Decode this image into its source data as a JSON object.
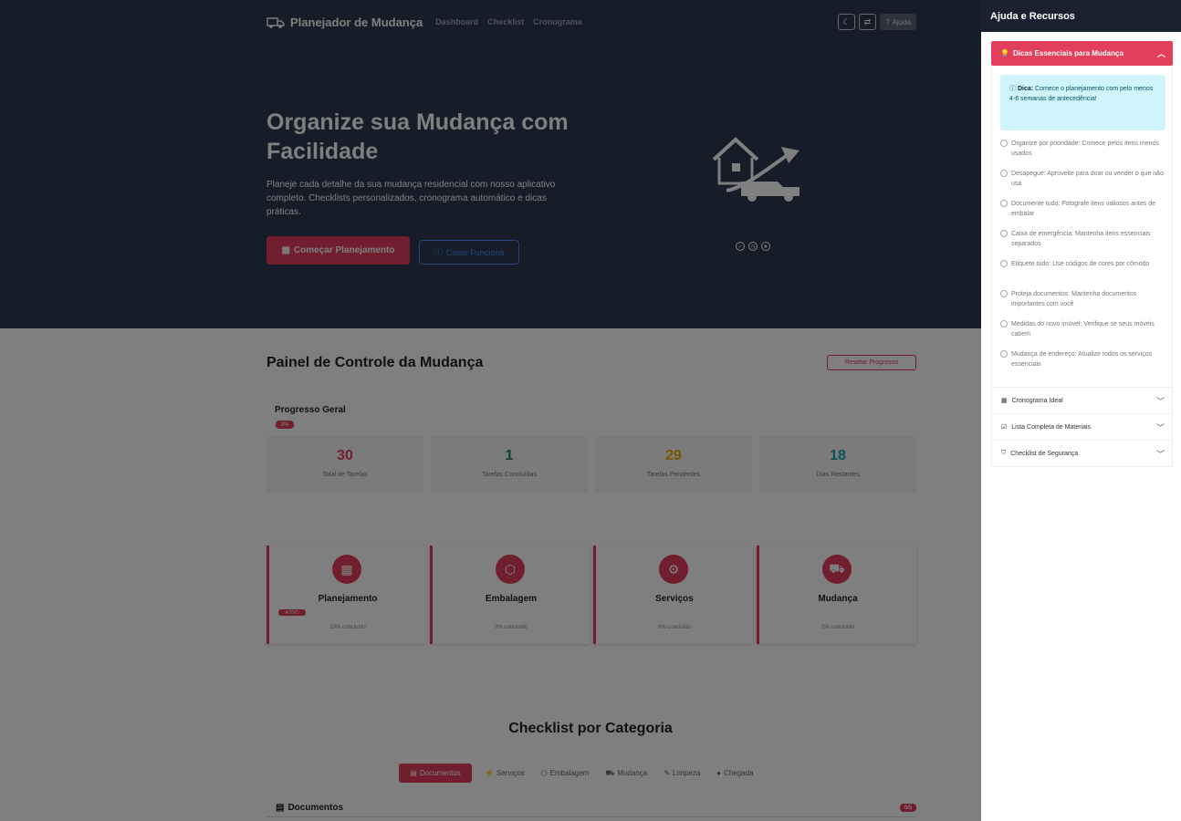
{
  "nav": {
    "brand": "Planejador de Mudança",
    "links": [
      "Dashboard",
      "Checklist",
      "Cronograma"
    ],
    "help_label": "Ajuda"
  },
  "hero": {
    "title": "Organize sua Mudança com Facilidade",
    "text": "Planeje cada detalhe da sua mudança residencial com nosso aplicativo completo. Checklists personalizados, cronograma automático e dicas práticas.",
    "primary_btn": "Começar Planejamento",
    "secondary_btn": "Como Funciona"
  },
  "dashboard": {
    "title": "Painel de Controle da Mudança",
    "reset_btn": "Resetar Progresso",
    "progress_label": "Progresso Geral",
    "progress_badge": "3%",
    "stats": [
      {
        "value": "30",
        "label": "Total de Tarefas",
        "color": "#e33e5c"
      },
      {
        "value": "1",
        "label": "Tarefas Concluídas",
        "color": "#198754"
      },
      {
        "value": "29",
        "label": "Tarefas Pendentes",
        "color": "#f0ad00"
      },
      {
        "value": "18",
        "label": "Dias Restantes",
        "color": "#17a2b8"
      }
    ]
  },
  "categories": [
    {
      "name": "Planejamento",
      "pct": "10% concluído",
      "badge": "ATIVO",
      "icon": "calendar-icon"
    },
    {
      "name": "Embalagem",
      "pct": "0% concluído",
      "icon": "box-icon"
    },
    {
      "name": "Serviços",
      "pct": "0% concluído",
      "icon": "gear-icon"
    },
    {
      "name": "Mudança",
      "pct": "0% concluído",
      "icon": "truck-icon"
    }
  ],
  "checklist": {
    "title": "Checklist por Categoria",
    "tabs": [
      "Documentos",
      "Serviços",
      "Embalagem",
      "Mudança",
      "Limpeza",
      "Chegada"
    ],
    "section_label": "Documentos",
    "section_badge": "0/5"
  },
  "panel": {
    "title": "Ajuda e Recursos",
    "open_section": "Dicas Essenciais para Mudança",
    "tip_bold": "Dica:",
    "tip_text": "Comece o planejamento com pelo menos 4-6 semanas de antecedência!",
    "tips": [
      "Organize por prioridade: Comece pelos itens menos usados",
      "Desapegue: Aproveite para doar ou vender o que não usa",
      "Documente tudo: Fotografe itens valiosos antes de embalar",
      "Caixa de emergência: Mantenha itens essenciais separados",
      "Etiquete tudo: Use códigos de cores por cômodo",
      "Proteja documentos: Mantenha documentos importantes com você",
      "Medidas do novo imóvel: Verifique se seus móveis cabem",
      "Mudança de endereço: Atualize todos os serviços essenciais"
    ],
    "sections": [
      "Cronograma Ideal",
      "Lista Completa de Materiais",
      "Checklist de Segurança"
    ]
  },
  "colors": {
    "accent": "#e33e5c",
    "hero_bg": "#2d3a52",
    "panel_head": "#1c2132"
  }
}
